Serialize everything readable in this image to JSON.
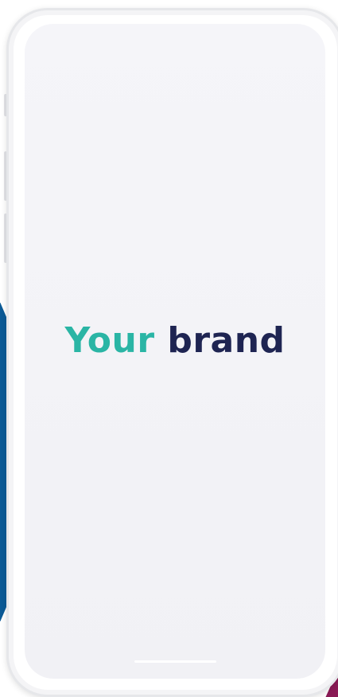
{
  "brand": {
    "word_primary": "Your",
    "word_secondary": "brand",
    "primary_color": "#2ab5a5",
    "secondary_color": "#1e2452"
  },
  "colors": {
    "screen_background": "#f3f3f7",
    "phone_frame": "#e6e7ea",
    "left_accent": "#0b5a96",
    "right_accent": "#8a1a55"
  }
}
